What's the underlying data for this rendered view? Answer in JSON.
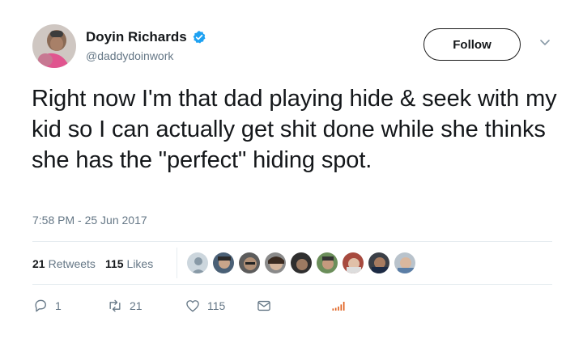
{
  "tweet": {
    "display_name": "Doyin Richards",
    "handle": "@daddydoinwork",
    "follow_label": "Follow",
    "text": "Right now I'm that dad playing hide & seek with my kid so I can actually get shit done while she thinks she has the \"perfect\" hiding spot.",
    "timestamp": "7:58 PM - 25 Jun 2017"
  },
  "stats": {
    "retweets_count": "21",
    "retweets_label": "Retweets",
    "likes_count": "115",
    "likes_label": "Likes"
  },
  "actions": {
    "reply_count": "1",
    "retweet_count": "21",
    "like_count": "115"
  },
  "icons": [
    "verified-icon",
    "chevron-down-icon",
    "reply-icon",
    "retweet-icon",
    "heart-icon",
    "message-icon",
    "analytics-icon"
  ],
  "colors": {
    "verified_blue": "#1da1f2",
    "secondary_text": "#657786",
    "analytics_orange": "#e0611f"
  }
}
